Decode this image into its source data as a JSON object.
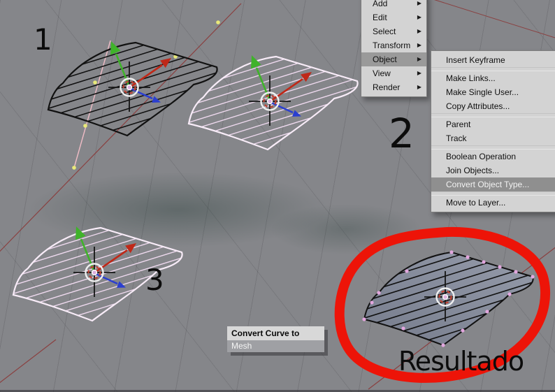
{
  "app": {
    "context_label": "Blender 3D viewport - curve to mesh tutorial"
  },
  "annotations": {
    "step1": "1",
    "step2": "2",
    "step3": "3",
    "result_label": "Resultado"
  },
  "menu": {
    "arrow_icon": "▶",
    "items": [
      {
        "label": "Add"
      },
      {
        "label": "Edit"
      },
      {
        "label": "Select"
      },
      {
        "label": "Transform"
      },
      {
        "label": "Object",
        "highlighted": true
      },
      {
        "label": "View"
      },
      {
        "label": "Render"
      }
    ]
  },
  "submenu": {
    "items": [
      {
        "label": "Insert Keyframe"
      },
      {
        "label": "Make Links..."
      },
      {
        "label": "Make Single User..."
      },
      {
        "label": "Copy Attributes..."
      },
      {
        "label": "Parent"
      },
      {
        "label": "Track"
      },
      {
        "label": "Boolean Operation"
      },
      {
        "label": "Join Objects..."
      },
      {
        "label": "Convert Object Type...",
        "highlighted": true
      },
      {
        "label": "Move to Layer..."
      }
    ]
  },
  "popup": {
    "title": "Convert Curve to",
    "options": [
      {
        "label": "Mesh",
        "highlighted": true
      }
    ]
  },
  "colors": {
    "viewport_bg": "#85868a",
    "menu_bg": "#d3d3d3",
    "menu_highlight": "#9a9a9a",
    "submenu_highlight": "#8f8f8f",
    "annotation_red": "#ed1408",
    "axis_x_arrow": "#bf2818",
    "axis_y_arrow": "#3fb32a",
    "axis_z_arrow": "#2a3ed0",
    "wire_black": "#111111",
    "wire_pink": "#eed9ee",
    "mesh_fill": "#858b9b",
    "grid_red_line": "#8a4040",
    "handle_yellow": "#e9e978"
  }
}
